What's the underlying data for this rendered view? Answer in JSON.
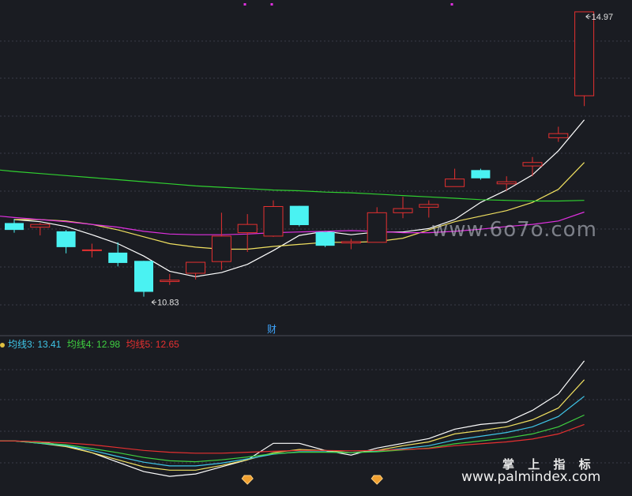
{
  "chart_data": [
    {
      "type": "candlestick",
      "panel": "price",
      "candles": [
        {
          "open": 11.9,
          "close": 11.8,
          "high": 11.96,
          "low": 11.76
        },
        {
          "open": 11.84,
          "close": 11.88,
          "high": 11.9,
          "low": 11.72
        },
        {
          "open": 11.78,
          "close": 11.55,
          "high": 11.8,
          "low": 11.46
        },
        {
          "open": 11.51,
          "close": 11.51,
          "high": 11.6,
          "low": 11.4
        },
        {
          "open": 11.47,
          "close": 11.32,
          "high": 11.62,
          "low": 11.27
        },
        {
          "open": 11.35,
          "close": 10.9,
          "high": 11.35,
          "low": 10.83
        },
        {
          "open": 11.05,
          "close": 11.07,
          "high": 11.16,
          "low": 11.0
        },
        {
          "open": 11.17,
          "close": 11.33,
          "high": 11.33,
          "low": 11.08
        },
        {
          "open": 11.34,
          "close": 11.71,
          "high": 12.05,
          "low": 11.22
        },
        {
          "open": 11.76,
          "close": 11.88,
          "high": 12.03,
          "low": 11.48
        },
        {
          "open": 11.71,
          "close": 12.14,
          "high": 12.23,
          "low": 11.7
        },
        {
          "open": 12.15,
          "close": 11.87,
          "high": 12.15,
          "low": 11.85
        },
        {
          "open": 11.77,
          "close": 11.57,
          "high": 11.77,
          "low": 11.55
        },
        {
          "open": 11.61,
          "close": 11.63,
          "high": 11.67,
          "low": 11.52
        },
        {
          "open": 11.62,
          "close": 12.05,
          "high": 12.13,
          "low": 11.62
        },
        {
          "open": 12.05,
          "close": 12.11,
          "high": 12.28,
          "low": 11.97
        },
        {
          "open": 12.13,
          "close": 12.17,
          "high": 12.23,
          "low": 11.98
        },
        {
          "open": 12.43,
          "close": 12.54,
          "high": 12.69,
          "low": 12.43
        },
        {
          "open": 12.67,
          "close": 12.55,
          "high": 12.69,
          "low": 12.53
        },
        {
          "open": 12.47,
          "close": 12.5,
          "high": 12.58,
          "low": 12.37
        },
        {
          "open": 12.73,
          "close": 12.78,
          "high": 12.86,
          "low": 12.58
        },
        {
          "open": 13.14,
          "close": 13.2,
          "high": 13.3,
          "low": 13.08
        },
        {
          "open": 13.75,
          "close": 14.97,
          "high": 14.97,
          "low": 13.6
        }
      ],
      "moving_averages": [
        {
          "color": "#ffffff",
          "values": [
            11.95,
            11.92,
            11.85,
            11.73,
            11.6,
            11.42,
            11.2,
            11.12,
            11.18,
            11.3,
            11.5,
            11.72,
            11.78,
            11.73,
            11.77,
            11.77,
            11.82,
            11.95,
            12.2,
            12.38,
            12.6,
            12.95,
            13.4
          ]
        },
        {
          "color": "#f0e060",
          "values": [
            11.95,
            11.95,
            11.93,
            11.88,
            11.8,
            11.7,
            11.6,
            11.55,
            11.52,
            11.52,
            11.56,
            11.59,
            11.62,
            11.62,
            11.63,
            11.68,
            11.8,
            11.92,
            12.0,
            12.08,
            12.2,
            12.39,
            12.78
          ]
        },
        {
          "color": "#e030e0",
          "values": [
            11.98,
            11.95,
            11.92,
            11.88,
            11.84,
            11.78,
            11.74,
            11.73,
            11.73,
            11.74,
            11.76,
            11.77,
            11.78,
            11.79,
            11.78,
            11.76,
            11.76,
            11.78,
            11.81,
            11.85,
            11.88,
            11.93,
            12.06
          ]
        },
        {
          "color": "#30d030",
          "values": [
            12.65,
            12.62,
            12.59,
            12.56,
            12.53,
            12.5,
            12.47,
            12.44,
            12.42,
            12.4,
            12.38,
            12.37,
            12.35,
            12.34,
            12.32,
            12.3,
            12.28,
            12.26,
            12.24,
            12.23,
            12.22,
            12.22,
            12.23
          ]
        }
      ],
      "annotations": [
        {
          "label": "10.83",
          "candle": 5,
          "type": "low"
        },
        {
          "label": "14.97",
          "candle": 22,
          "type": "high"
        }
      ],
      "marker": "财",
      "ylim": [
        10.55,
        15.05
      ]
    },
    {
      "type": "line",
      "panel": "indicator",
      "legend": [
        {
          "label": "均线3: 13.41",
          "color": "#3fc6e8"
        },
        {
          "label": "均线4: 12.98",
          "color": "#3fd040"
        },
        {
          "label": "均线5: 12.65",
          "color": "#e63030"
        }
      ],
      "series": [
        {
          "color": "#ffffff",
          "values": [
            11.9,
            11.88,
            11.8,
            11.65,
            11.45,
            11.25,
            11.15,
            11.2,
            11.35,
            11.5,
            11.85,
            11.85,
            11.7,
            11.6,
            11.75,
            11.85,
            11.95,
            12.15,
            12.25,
            12.3,
            12.55,
            12.9,
            13.6
          ]
        },
        {
          "color": "#f0e060",
          "values": [
            11.9,
            11.85,
            11.78,
            11.65,
            11.5,
            11.35,
            11.28,
            11.28,
            11.38,
            11.5,
            11.65,
            11.72,
            11.7,
            11.65,
            11.7,
            11.8,
            11.88,
            12.05,
            12.12,
            12.2,
            12.35,
            12.6,
            13.2
          ]
        },
        {
          "color": "#3fc6e8",
          "values": [
            11.9,
            11.85,
            11.8,
            11.7,
            11.57,
            11.45,
            11.37,
            11.37,
            11.43,
            11.52,
            11.62,
            11.67,
            11.67,
            11.65,
            11.68,
            11.74,
            11.8,
            11.92,
            12.0,
            12.08,
            12.2,
            12.42,
            12.85
          ]
        },
        {
          "color": "#3fd040",
          "values": [
            11.9,
            11.86,
            11.82,
            11.74,
            11.65,
            11.55,
            11.48,
            11.46,
            11.5,
            11.56,
            11.63,
            11.66,
            11.66,
            11.65,
            11.67,
            11.71,
            11.75,
            11.84,
            11.9,
            11.96,
            12.05,
            12.2,
            12.45
          ]
        },
        {
          "color": "#e63030",
          "values": [
            11.9,
            11.88,
            11.86,
            11.82,
            11.76,
            11.7,
            11.66,
            11.64,
            11.64,
            11.66,
            11.68,
            11.7,
            11.7,
            11.69,
            11.7,
            11.72,
            11.74,
            11.8,
            11.84,
            11.88,
            11.94,
            12.05,
            12.25
          ]
        }
      ],
      "signals": [
        9,
        14
      ],
      "ylim": [
        11.0,
        13.8
      ]
    }
  ],
  "watermarks": {
    "top": "www.6o7o.com",
    "brand_cn": "掌 上 指 标",
    "brand_url": "www.palmindex.com"
  },
  "colors": {
    "background": "#1a1c22",
    "grid": "#3a3d48",
    "up": "#e63030",
    "down": "#4af2f2"
  }
}
